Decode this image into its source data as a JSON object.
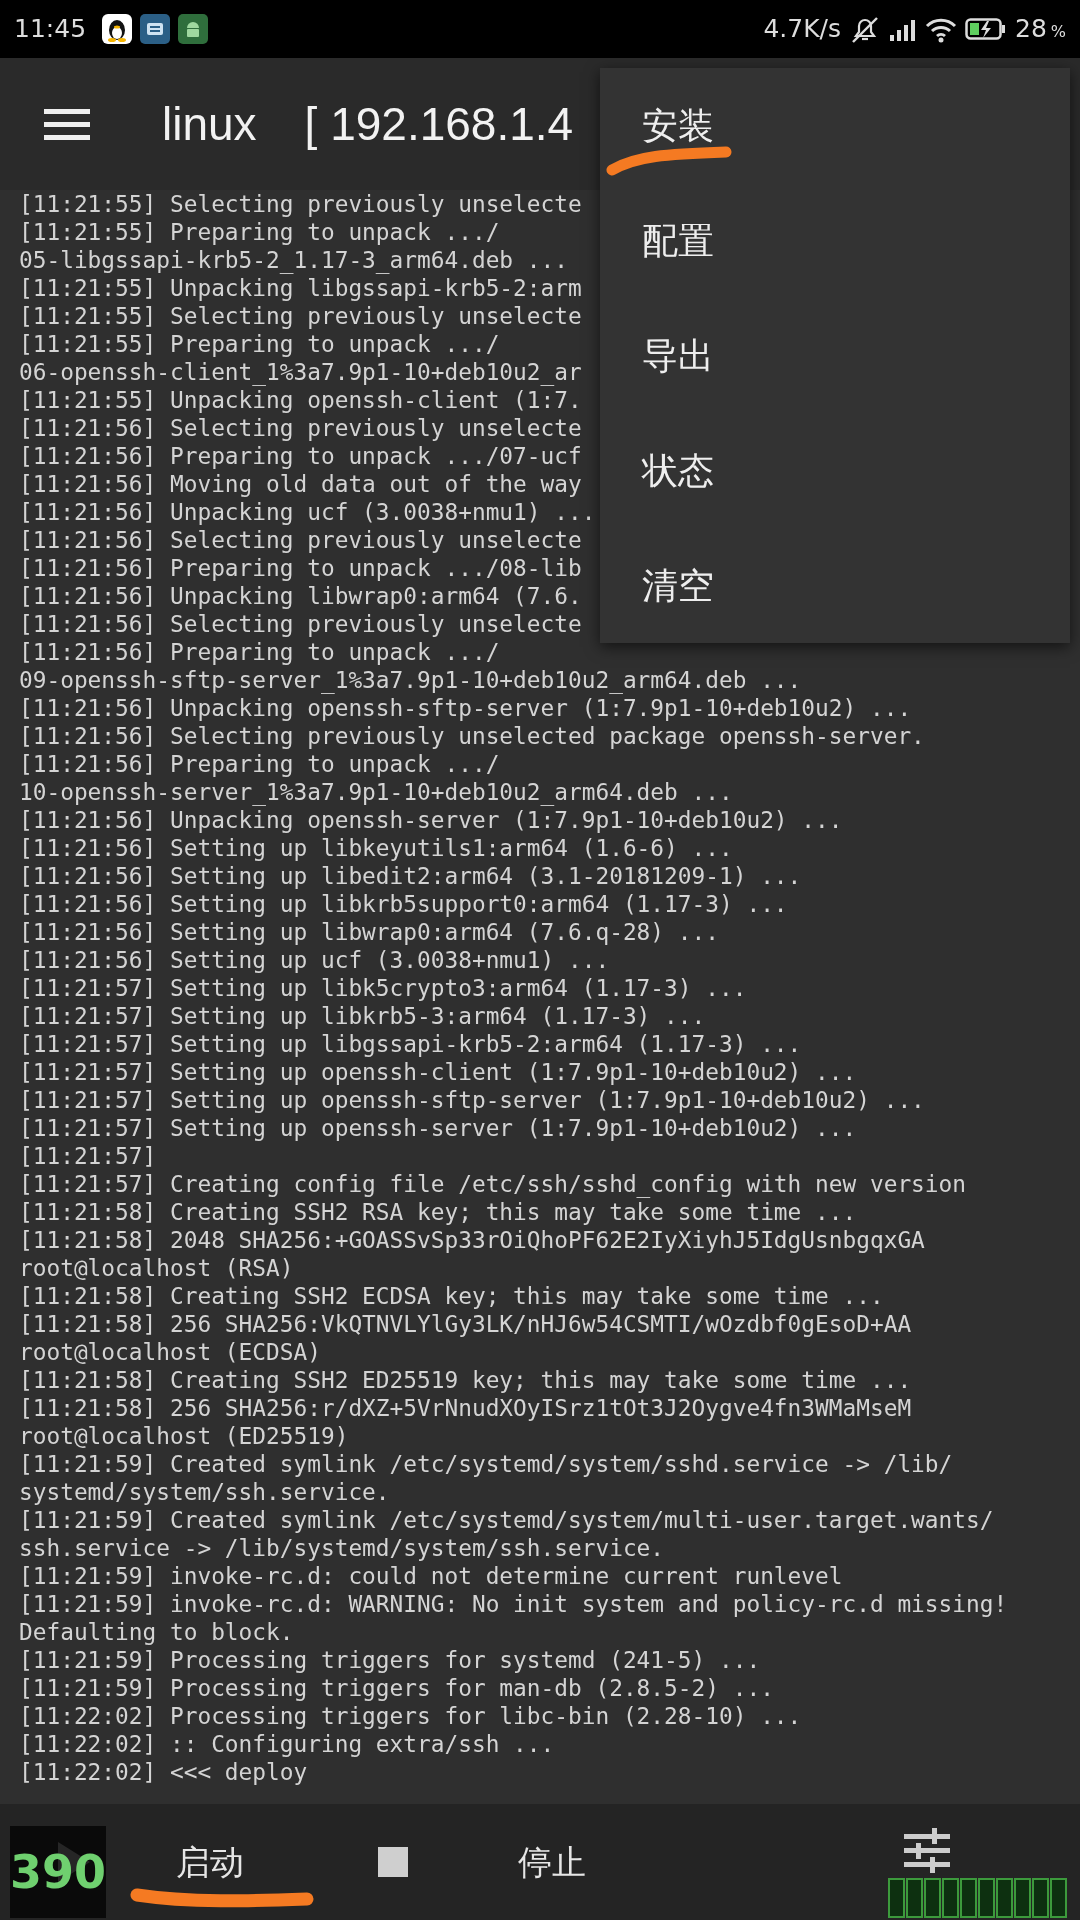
{
  "status_bar": {
    "time": "11:45",
    "speed": "4.7K/s",
    "battery": "28",
    "battery_unit": "%"
  },
  "toolbar": {
    "title": "linux",
    "host": "[ 192.168.1.4"
  },
  "log": [
    "[11:21:55] Selecting previously unselecte",
    "[11:21:55] Preparing to unpack .../",
    "05-libgssapi-krb5-2_1.17-3_arm64.deb ...",
    "[11:21:55] Unpacking libgssapi-krb5-2:arm",
    "[11:21:55] Selecting previously unselecte",
    "[11:21:55] Preparing to unpack .../",
    "06-openssh-client_1%3a7.9p1-10+deb10u2_ar",
    "[11:21:55] Unpacking openssh-client (1:7.",
    "[11:21:56] Selecting previously unselecte",
    "[11:21:56] Preparing to unpack .../07-ucf",
    "[11:21:56] Moving old data out of the way",
    "[11:21:56] Unpacking ucf (3.0038+nmu1) ...",
    "[11:21:56] Selecting previously unselecte",
    "[11:21:56] Preparing to unpack .../08-lib",
    "[11:21:56] Unpacking libwrap0:arm64 (7.6.",
    "[11:21:56] Selecting previously unselecte",
    "[11:21:56] Preparing to unpack .../",
    "09-openssh-sftp-server_1%3a7.9p1-10+deb10u2_arm64.deb ...",
    "[11:21:56] Unpacking openssh-sftp-server (1:7.9p1-10+deb10u2) ...",
    "[11:21:56] Selecting previously unselected package openssh-server.",
    "[11:21:56] Preparing to unpack .../",
    "10-openssh-server_1%3a7.9p1-10+deb10u2_arm64.deb ...",
    "[11:21:56] Unpacking openssh-server (1:7.9p1-10+deb10u2) ...",
    "[11:21:56] Setting up libkeyutils1:arm64 (1.6-6) ...",
    "[11:21:56] Setting up libedit2:arm64 (3.1-20181209-1) ...",
    "[11:21:56] Setting up libkrb5support0:arm64 (1.17-3) ...",
    "[11:21:56] Setting up libwrap0:arm64 (7.6.q-28) ...",
    "[11:21:56] Setting up ucf (3.0038+nmu1) ...",
    "[11:21:57] Setting up libk5crypto3:arm64 (1.17-3) ...",
    "[11:21:57] Setting up libkrb5-3:arm64 (1.17-3) ...",
    "[11:21:57] Setting up libgssapi-krb5-2:arm64 (1.17-3) ...",
    "[11:21:57] Setting up openssh-client (1:7.9p1-10+deb10u2) ...",
    "[11:21:57] Setting up openssh-sftp-server (1:7.9p1-10+deb10u2) ...",
    "[11:21:57] Setting up openssh-server (1:7.9p1-10+deb10u2) ...",
    "[11:21:57]",
    "[11:21:57] Creating config file /etc/ssh/sshd_config with new version",
    "[11:21:58] Creating SSH2 RSA key; this may take some time ...",
    "[11:21:58] 2048 SHA256:+GOASSvSp33rOiQhoPF62E2IyXiyhJ5IdgUsnbgqxGA",
    "root@localhost (RSA)",
    "[11:21:58] Creating SSH2 ECDSA key; this may take some time ...",
    "[11:21:58] 256 SHA256:VkQTNVLYlGy3LK/nHJ6w54CSMTI/wOzdbf0gEsoD+AA",
    "root@localhost (ECDSA)",
    "[11:21:58] Creating SSH2 ED25519 key; this may take some time ...",
    "[11:21:58] 256 SHA256:r/dXZ+5VrNnudXOyISrz1tOt3J2Oygve4fn3WMaMseM",
    "root@localhost (ED25519)",
    "[11:21:59] Created symlink /etc/systemd/system/sshd.service -> /lib/",
    "systemd/system/ssh.service.",
    "[11:21:59] Created symlink /etc/systemd/system/multi-user.target.wants/",
    "ssh.service -> /lib/systemd/system/ssh.service.",
    "[11:21:59] invoke-rc.d: could not determine current runlevel",
    "[11:21:59] invoke-rc.d: WARNING: No init system and policy-rc.d missing!",
    "Defaulting to block.",
    "[11:21:59] Processing triggers for systemd (241-5) ...",
    "[11:21:59] Processing triggers for man-db (2.8.5-2) ...",
    "[11:22:02] Processing triggers for libc-bin (2.28-10) ...",
    "[11:22:02] :: Configuring extra/ssh ...",
    "[11:22:02] <<< deploy"
  ],
  "menu": [
    {
      "label": "安装",
      "annotated": true
    },
    {
      "label": "配置",
      "annotated": false
    },
    {
      "label": "导出",
      "annotated": false
    },
    {
      "label": "状态",
      "annotated": false
    },
    {
      "label": "清空",
      "annotated": false
    }
  ],
  "bottom_bar": {
    "buttons": [
      {
        "kind": "start",
        "label": "启动",
        "annotated": true
      },
      {
        "kind": "stop",
        "label": "停止",
        "annotated": false
      }
    ]
  },
  "overlay": {
    "counter": "390"
  }
}
